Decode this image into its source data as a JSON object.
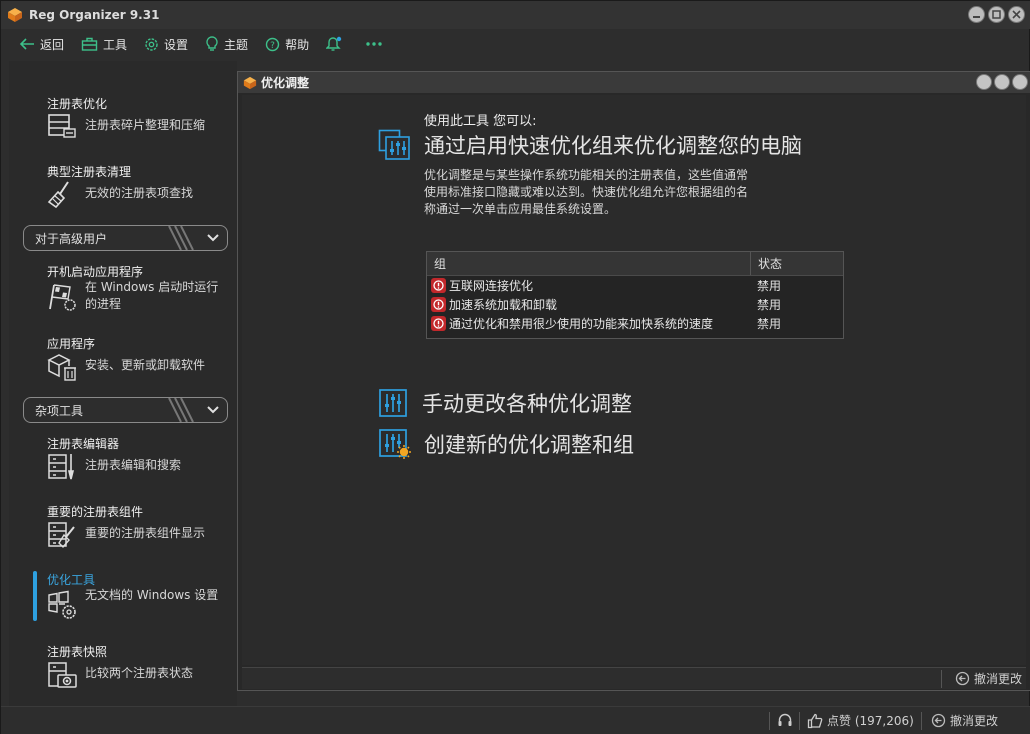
{
  "window": {
    "title": "Reg Organizer 9.31"
  },
  "toolbar": {
    "back": "返回",
    "tools": "工具",
    "settings": "设置",
    "theme": "主题",
    "help": "帮助"
  },
  "sidebar": {
    "items": [
      {
        "title": "注册表优化",
        "desc": "注册表碎片整理和压缩",
        "icon": "registry-defrag-icon"
      },
      {
        "title": "典型注册表清理",
        "desc": "无效的注册表项查找",
        "icon": "broom-icon"
      },
      {
        "title": "开机启动应用程序",
        "desc": "在 Windows 启动时运行的进程",
        "icon": "startup-flag-icon"
      },
      {
        "title": "应用程序",
        "desc": "安装、更新或卸载软件",
        "icon": "box-trash-icon"
      },
      {
        "title": "注册表编辑器",
        "desc": "注册表编辑和搜索",
        "icon": "registry-editor-icon"
      },
      {
        "title": "重要的注册表组件",
        "desc": "重要的注册表组件显示",
        "icon": "registry-components-icon"
      },
      {
        "title": "优化工具",
        "desc": "无文档的 Windows 设置",
        "icon": "windows-gear-icon"
      },
      {
        "title": "注册表快照",
        "desc": "比较两个注册表状态",
        "icon": "camera-icon"
      }
    ],
    "groups": {
      "advanced": "对于高级用户",
      "misc": "杂项工具"
    }
  },
  "child": {
    "title": "优化调整",
    "intro": "使用此工具 您可以:",
    "section1": "通过启用快速优化组来优化调整您的电脑",
    "desc": "优化调整是与某些操作系统功能相关的注册表值，这些值通常使用标准接口隐藏或难以达到。快速优化组允许您根据组的名称通过一次单击应用最佳系统设置。",
    "table": {
      "col_group": "组",
      "col_status": "状态",
      "rows": [
        {
          "name": "互联网连接优化",
          "status": "禁用"
        },
        {
          "name": "加速系统加载和卸载",
          "status": "禁用"
        },
        {
          "name": "通过优化和禁用很少使用的功能来加快系统的速度",
          "status": "禁用"
        }
      ]
    },
    "section2": "手动更改各种优化调整",
    "section3": "创建新的优化调整和组",
    "undo": "撤消更改"
  },
  "statusbar": {
    "likes": "点赞 (197,206)",
    "undo": "撤消更改"
  },
  "colors": {
    "accent": "#2ea0e0",
    "error": "#c2282b",
    "logo": "#f0922b"
  }
}
